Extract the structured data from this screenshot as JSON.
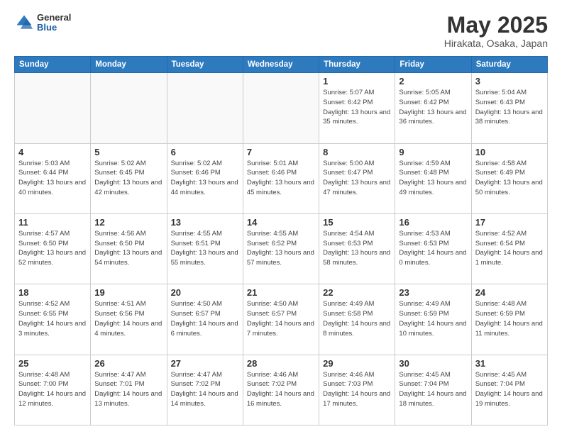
{
  "header": {
    "logo": {
      "line1": "General",
      "line2": "Blue"
    },
    "title": "May 2025",
    "subtitle": "Hirakata, Osaka, Japan"
  },
  "days_of_week": [
    "Sunday",
    "Monday",
    "Tuesday",
    "Wednesday",
    "Thursday",
    "Friday",
    "Saturday"
  ],
  "weeks": [
    [
      {
        "day": "",
        "sunrise": "",
        "sunset": "",
        "daylight": "",
        "empty": true
      },
      {
        "day": "",
        "sunrise": "",
        "sunset": "",
        "daylight": "",
        "empty": true
      },
      {
        "day": "",
        "sunrise": "",
        "sunset": "",
        "daylight": "",
        "empty": true
      },
      {
        "day": "",
        "sunrise": "",
        "sunset": "",
        "daylight": "",
        "empty": true
      },
      {
        "day": "1",
        "sunrise": "5:07 AM",
        "sunset": "6:42 PM",
        "daylight": "13 hours and 35 minutes.",
        "empty": false
      },
      {
        "day": "2",
        "sunrise": "5:05 AM",
        "sunset": "6:42 PM",
        "daylight": "13 hours and 36 minutes.",
        "empty": false
      },
      {
        "day": "3",
        "sunrise": "5:04 AM",
        "sunset": "6:43 PM",
        "daylight": "13 hours and 38 minutes.",
        "empty": false
      }
    ],
    [
      {
        "day": "4",
        "sunrise": "5:03 AM",
        "sunset": "6:44 PM",
        "daylight": "13 hours and 40 minutes.",
        "empty": false
      },
      {
        "day": "5",
        "sunrise": "5:02 AM",
        "sunset": "6:45 PM",
        "daylight": "13 hours and 42 minutes.",
        "empty": false
      },
      {
        "day": "6",
        "sunrise": "5:02 AM",
        "sunset": "6:46 PM",
        "daylight": "13 hours and 44 minutes.",
        "empty": false
      },
      {
        "day": "7",
        "sunrise": "5:01 AM",
        "sunset": "6:46 PM",
        "daylight": "13 hours and 45 minutes.",
        "empty": false
      },
      {
        "day": "8",
        "sunrise": "5:00 AM",
        "sunset": "6:47 PM",
        "daylight": "13 hours and 47 minutes.",
        "empty": false
      },
      {
        "day": "9",
        "sunrise": "4:59 AM",
        "sunset": "6:48 PM",
        "daylight": "13 hours and 49 minutes.",
        "empty": false
      },
      {
        "day": "10",
        "sunrise": "4:58 AM",
        "sunset": "6:49 PM",
        "daylight": "13 hours and 50 minutes.",
        "empty": false
      }
    ],
    [
      {
        "day": "11",
        "sunrise": "4:57 AM",
        "sunset": "6:50 PM",
        "daylight": "13 hours and 52 minutes.",
        "empty": false
      },
      {
        "day": "12",
        "sunrise": "4:56 AM",
        "sunset": "6:50 PM",
        "daylight": "13 hours and 54 minutes.",
        "empty": false
      },
      {
        "day": "13",
        "sunrise": "4:55 AM",
        "sunset": "6:51 PM",
        "daylight": "13 hours and 55 minutes.",
        "empty": false
      },
      {
        "day": "14",
        "sunrise": "4:55 AM",
        "sunset": "6:52 PM",
        "daylight": "13 hours and 57 minutes.",
        "empty": false
      },
      {
        "day": "15",
        "sunrise": "4:54 AM",
        "sunset": "6:53 PM",
        "daylight": "13 hours and 58 minutes.",
        "empty": false
      },
      {
        "day": "16",
        "sunrise": "4:53 AM",
        "sunset": "6:53 PM",
        "daylight": "14 hours and 0 minutes.",
        "empty": false
      },
      {
        "day": "17",
        "sunrise": "4:52 AM",
        "sunset": "6:54 PM",
        "daylight": "14 hours and 1 minute.",
        "empty": false
      }
    ],
    [
      {
        "day": "18",
        "sunrise": "4:52 AM",
        "sunset": "6:55 PM",
        "daylight": "14 hours and 3 minutes.",
        "empty": false
      },
      {
        "day": "19",
        "sunrise": "4:51 AM",
        "sunset": "6:56 PM",
        "daylight": "14 hours and 4 minutes.",
        "empty": false
      },
      {
        "day": "20",
        "sunrise": "4:50 AM",
        "sunset": "6:57 PM",
        "daylight": "14 hours and 6 minutes.",
        "empty": false
      },
      {
        "day": "21",
        "sunrise": "4:50 AM",
        "sunset": "6:57 PM",
        "daylight": "14 hours and 7 minutes.",
        "empty": false
      },
      {
        "day": "22",
        "sunrise": "4:49 AM",
        "sunset": "6:58 PM",
        "daylight": "14 hours and 8 minutes.",
        "empty": false
      },
      {
        "day": "23",
        "sunrise": "4:49 AM",
        "sunset": "6:59 PM",
        "daylight": "14 hours and 10 minutes.",
        "empty": false
      },
      {
        "day": "24",
        "sunrise": "4:48 AM",
        "sunset": "6:59 PM",
        "daylight": "14 hours and 11 minutes.",
        "empty": false
      }
    ],
    [
      {
        "day": "25",
        "sunrise": "4:48 AM",
        "sunset": "7:00 PM",
        "daylight": "14 hours and 12 minutes.",
        "empty": false
      },
      {
        "day": "26",
        "sunrise": "4:47 AM",
        "sunset": "7:01 PM",
        "daylight": "14 hours and 13 minutes.",
        "empty": false
      },
      {
        "day": "27",
        "sunrise": "4:47 AM",
        "sunset": "7:02 PM",
        "daylight": "14 hours and 14 minutes.",
        "empty": false
      },
      {
        "day": "28",
        "sunrise": "4:46 AM",
        "sunset": "7:02 PM",
        "daylight": "14 hours and 16 minutes.",
        "empty": false
      },
      {
        "day": "29",
        "sunrise": "4:46 AM",
        "sunset": "7:03 PM",
        "daylight": "14 hours and 17 minutes.",
        "empty": false
      },
      {
        "day": "30",
        "sunrise": "4:45 AM",
        "sunset": "7:04 PM",
        "daylight": "14 hours and 18 minutes.",
        "empty": false
      },
      {
        "day": "31",
        "sunrise": "4:45 AM",
        "sunset": "7:04 PM",
        "daylight": "14 hours and 19 minutes.",
        "empty": false
      }
    ]
  ]
}
